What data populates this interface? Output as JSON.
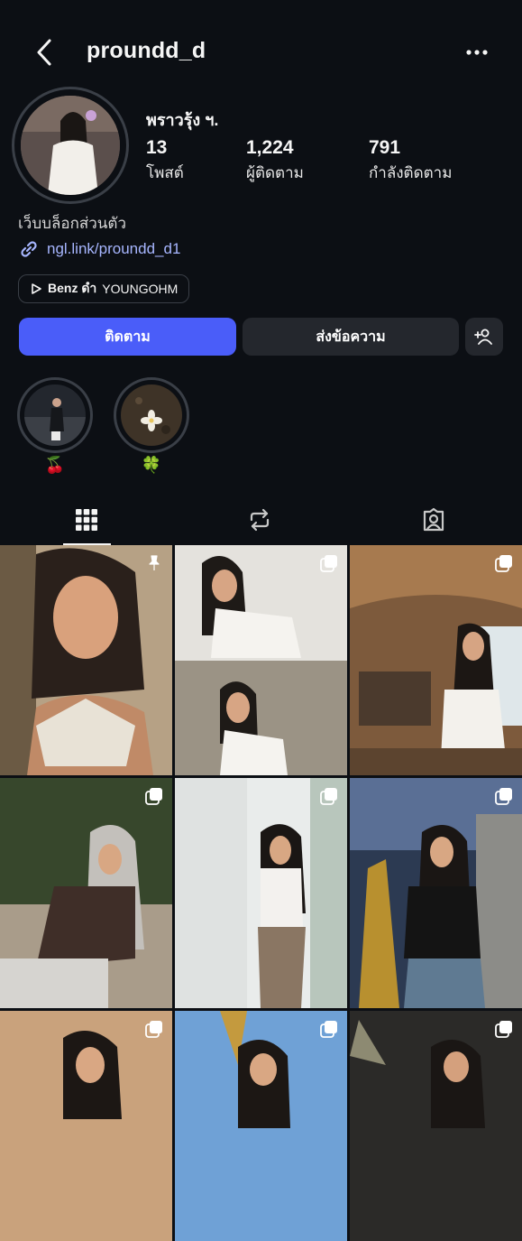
{
  "header": {
    "username": "proundd_d",
    "back_icon": "chevron-left-icon",
    "more_icon": "ellipsis-icon"
  },
  "profile": {
    "display_name": "พราวรุ้ง ฯ.",
    "stats": [
      {
        "value": "13",
        "label": "โพสต์"
      },
      {
        "value": "1,224",
        "label": "ผู้ติดตาม"
      },
      {
        "value": "791",
        "label": "กำลังติดตาม"
      }
    ],
    "bio": "เว็บบล็อกส่วนตัว",
    "link": "ngl.link/proundd_d1",
    "music": {
      "artist": "Benz ดำ",
      "song": "YOUNGOHM"
    }
  },
  "actions": {
    "follow_label": "ติดตาม",
    "message_label": "ส่งข้อความ",
    "suggest_icon": "add-person-icon"
  },
  "highlights": [
    {
      "label": "🍒"
    },
    {
      "label": "🍀"
    }
  ],
  "tabs": [
    {
      "icon": "grid-icon",
      "selected": true
    },
    {
      "icon": "reposts-icon",
      "selected": false
    },
    {
      "icon": "tagged-icon",
      "selected": false
    }
  ],
  "posts": [
    {
      "type": "pinned"
    },
    {
      "type": "carousel"
    },
    {
      "type": "carousel"
    },
    {
      "type": "carousel"
    },
    {
      "type": "carousel"
    },
    {
      "type": "carousel"
    },
    {
      "type": "carousel"
    },
    {
      "type": "carousel"
    },
    {
      "type": "carousel"
    }
  ],
  "colors": {
    "background": "#0c0f14",
    "follow_button": "#4a5df9",
    "secondary_button": "#24272d",
    "link": "#a7b6ff"
  }
}
